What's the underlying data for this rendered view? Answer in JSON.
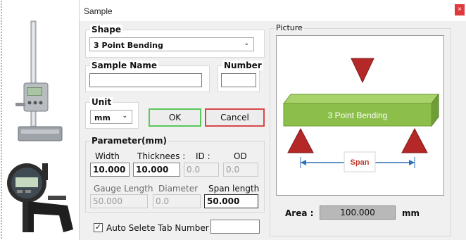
{
  "window": {
    "title": "Sample",
    "close_label": "×"
  },
  "shape": {
    "group_label": "Shape",
    "selected": "3 Point Bending"
  },
  "sample_name": {
    "group_label": "Sample Name",
    "value": ""
  },
  "number": {
    "group_label": "Number",
    "value": ""
  },
  "unit": {
    "group_label": "Unit",
    "selected": "mm"
  },
  "buttons": {
    "ok": "OK",
    "cancel": "Cancel"
  },
  "parameter": {
    "group_label": "Parameter(mm)",
    "width_label": "Width",
    "width_value": "10.000",
    "thickness_label": "Thicknees :",
    "thickness_value": "10.000",
    "id_label": "ID :",
    "id_value": "0.0",
    "od_label": "OD",
    "od_value": "0.0",
    "gauge_length_label": "Gauge Length",
    "gauge_length_value": "50.000",
    "diameter_label": "Diameter",
    "diameter_value": "0.0",
    "span_length_label": "Span length",
    "span_length_value": "50.000"
  },
  "auto_tab": {
    "label": "Auto Selete Tab Number :",
    "checked": true,
    "value": ""
  },
  "picture": {
    "group_label": "Picture",
    "beam_label": "3 Point Bending",
    "span_label": "Span",
    "colors": {
      "beam": "#8bbf4a",
      "arrow": "#b52828",
      "span_text": "#c0392b",
      "span_line": "#2f6fb5"
    }
  },
  "area": {
    "label": "Area :",
    "value": "100.000",
    "unit": "mm"
  },
  "side_images": {
    "top": "height-gauge",
    "bottom": "thickness-dial-gauge"
  }
}
